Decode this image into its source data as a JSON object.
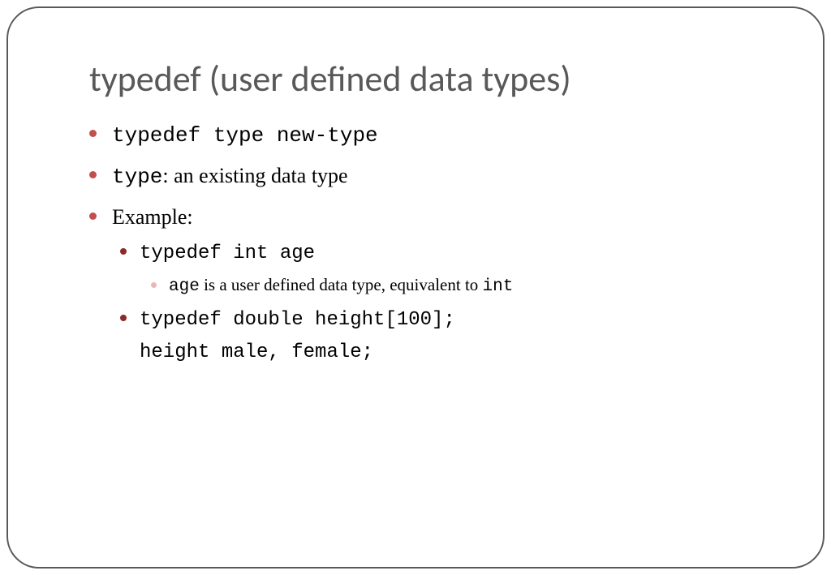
{
  "title": "typedef (user defined data types)",
  "bullets": {
    "b1_code": "typedef type new-type",
    "b2_code": "type",
    "b2_text": ": an existing data type",
    "b3_text": "Example:",
    "b3a_code": "typedef int age",
    "b3a1_code1": "age",
    "b3a1_text": " is a user defined data type, equivalent to ",
    "b3a1_code2": "int",
    "b3b_line1": "typedef double height[100];",
    "b3b_line2": "height male, female;"
  }
}
